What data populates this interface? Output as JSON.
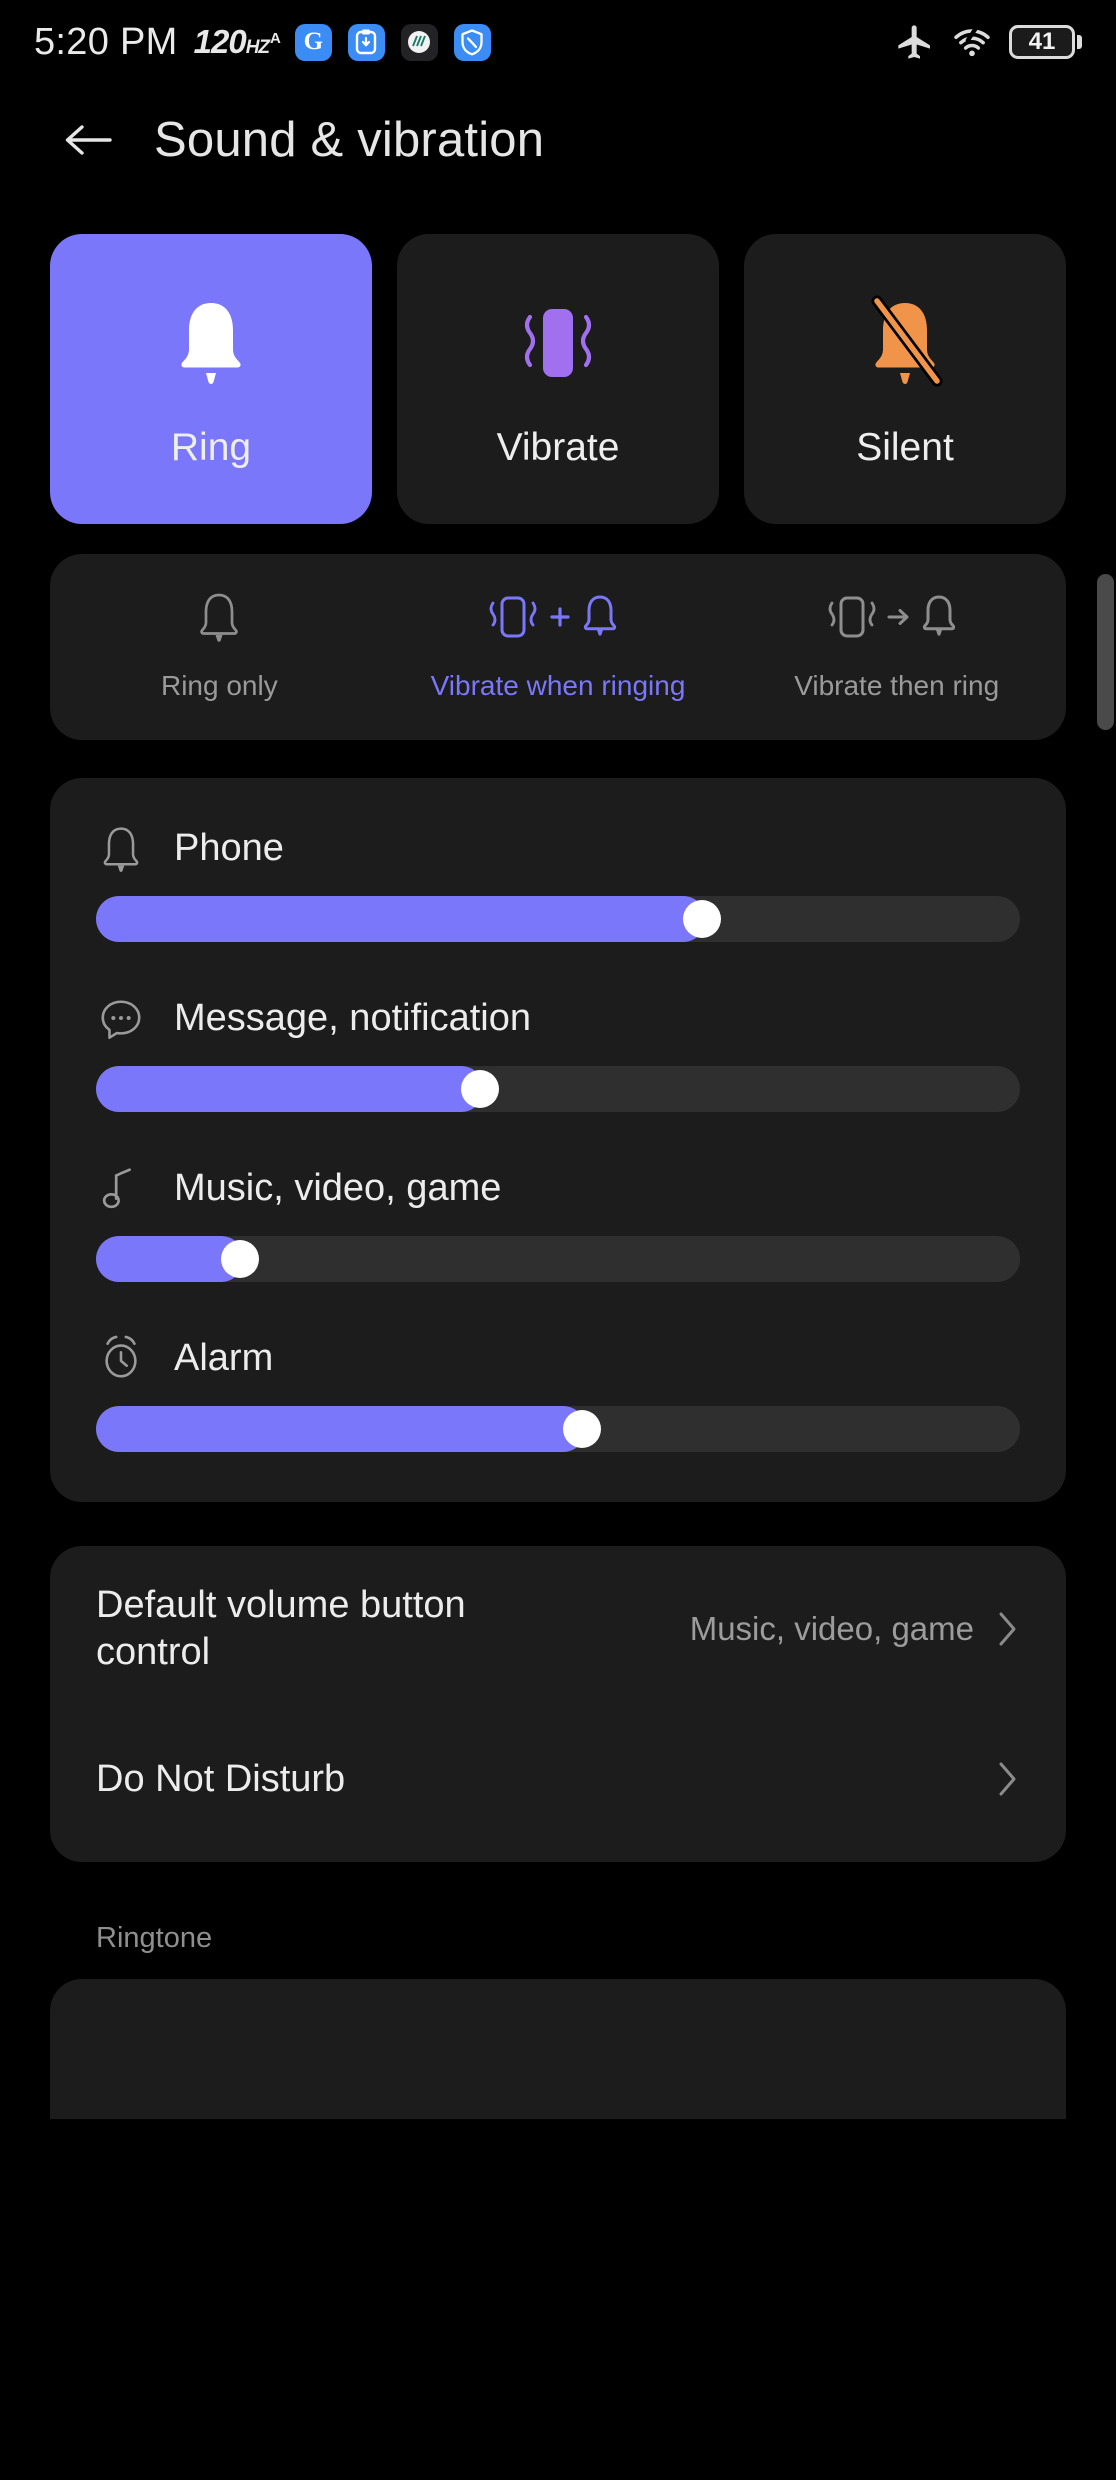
{
  "status_bar": {
    "time": "5:20 PM",
    "refresh_rate": "120",
    "refresh_rate_unit": "HZ",
    "refresh_rate_auto": "A",
    "app_icons": [
      {
        "name": "google-icon",
        "glyph": "G"
      },
      {
        "name": "clipboard-icon",
        "glyph": "⬇"
      },
      {
        "name": "app-dark-icon",
        "glyph": "●"
      },
      {
        "name": "shield-icon",
        "glyph": "⛨"
      }
    ],
    "airplane_mode_icon": "airplane-icon",
    "wifi_icon": "wifi-icon",
    "battery_percent": "41"
  },
  "header": {
    "back_icon": "back-arrow-icon",
    "title": "Sound & vibration"
  },
  "modes": {
    "selected": "Ring",
    "items": [
      {
        "label": "Ring",
        "icon": "bell-icon",
        "selected": true
      },
      {
        "label": "Vibrate",
        "icon": "vibrate-icon",
        "selected": false
      },
      {
        "label": "Silent",
        "icon": "bell-crossed-icon",
        "selected": false
      }
    ]
  },
  "sub_options": {
    "selected": "Vibrate when ringing",
    "items": [
      {
        "label": "Ring only",
        "icons": "bell-icon",
        "active": false
      },
      {
        "label": "Vibrate when ringing",
        "icons": "vibrate-plus-bell-icon",
        "active": true
      },
      {
        "label": "Vibrate then ring",
        "icons": "vibrate-arrow-bell-icon",
        "active": false
      }
    ]
  },
  "volumes": [
    {
      "label": "Phone",
      "icon": "bell-icon",
      "percent": 66
    },
    {
      "label": "Message, notification",
      "icon": "message-icon",
      "percent": 42
    },
    {
      "label": "Music, video, game",
      "icon": "music-icon",
      "percent": 16
    },
    {
      "label": "Alarm",
      "icon": "alarm-icon",
      "percent": 53
    }
  ],
  "settings_list": [
    {
      "title": "Default volume button control",
      "value": "Music, video, game",
      "chevron": "chevron-right-icon"
    },
    {
      "title": "Do Not Disturb",
      "value": "",
      "chevron": "chevron-right-icon"
    }
  ],
  "sections": {
    "ringtone_label": "Ringtone"
  },
  "colors": {
    "accent": "#7a77fa",
    "card": "#1c1c1c",
    "track": "#2f2f2f",
    "silent_orange": "#f0944a",
    "vibrate_purple": "#a070ee",
    "background": "#000000"
  }
}
